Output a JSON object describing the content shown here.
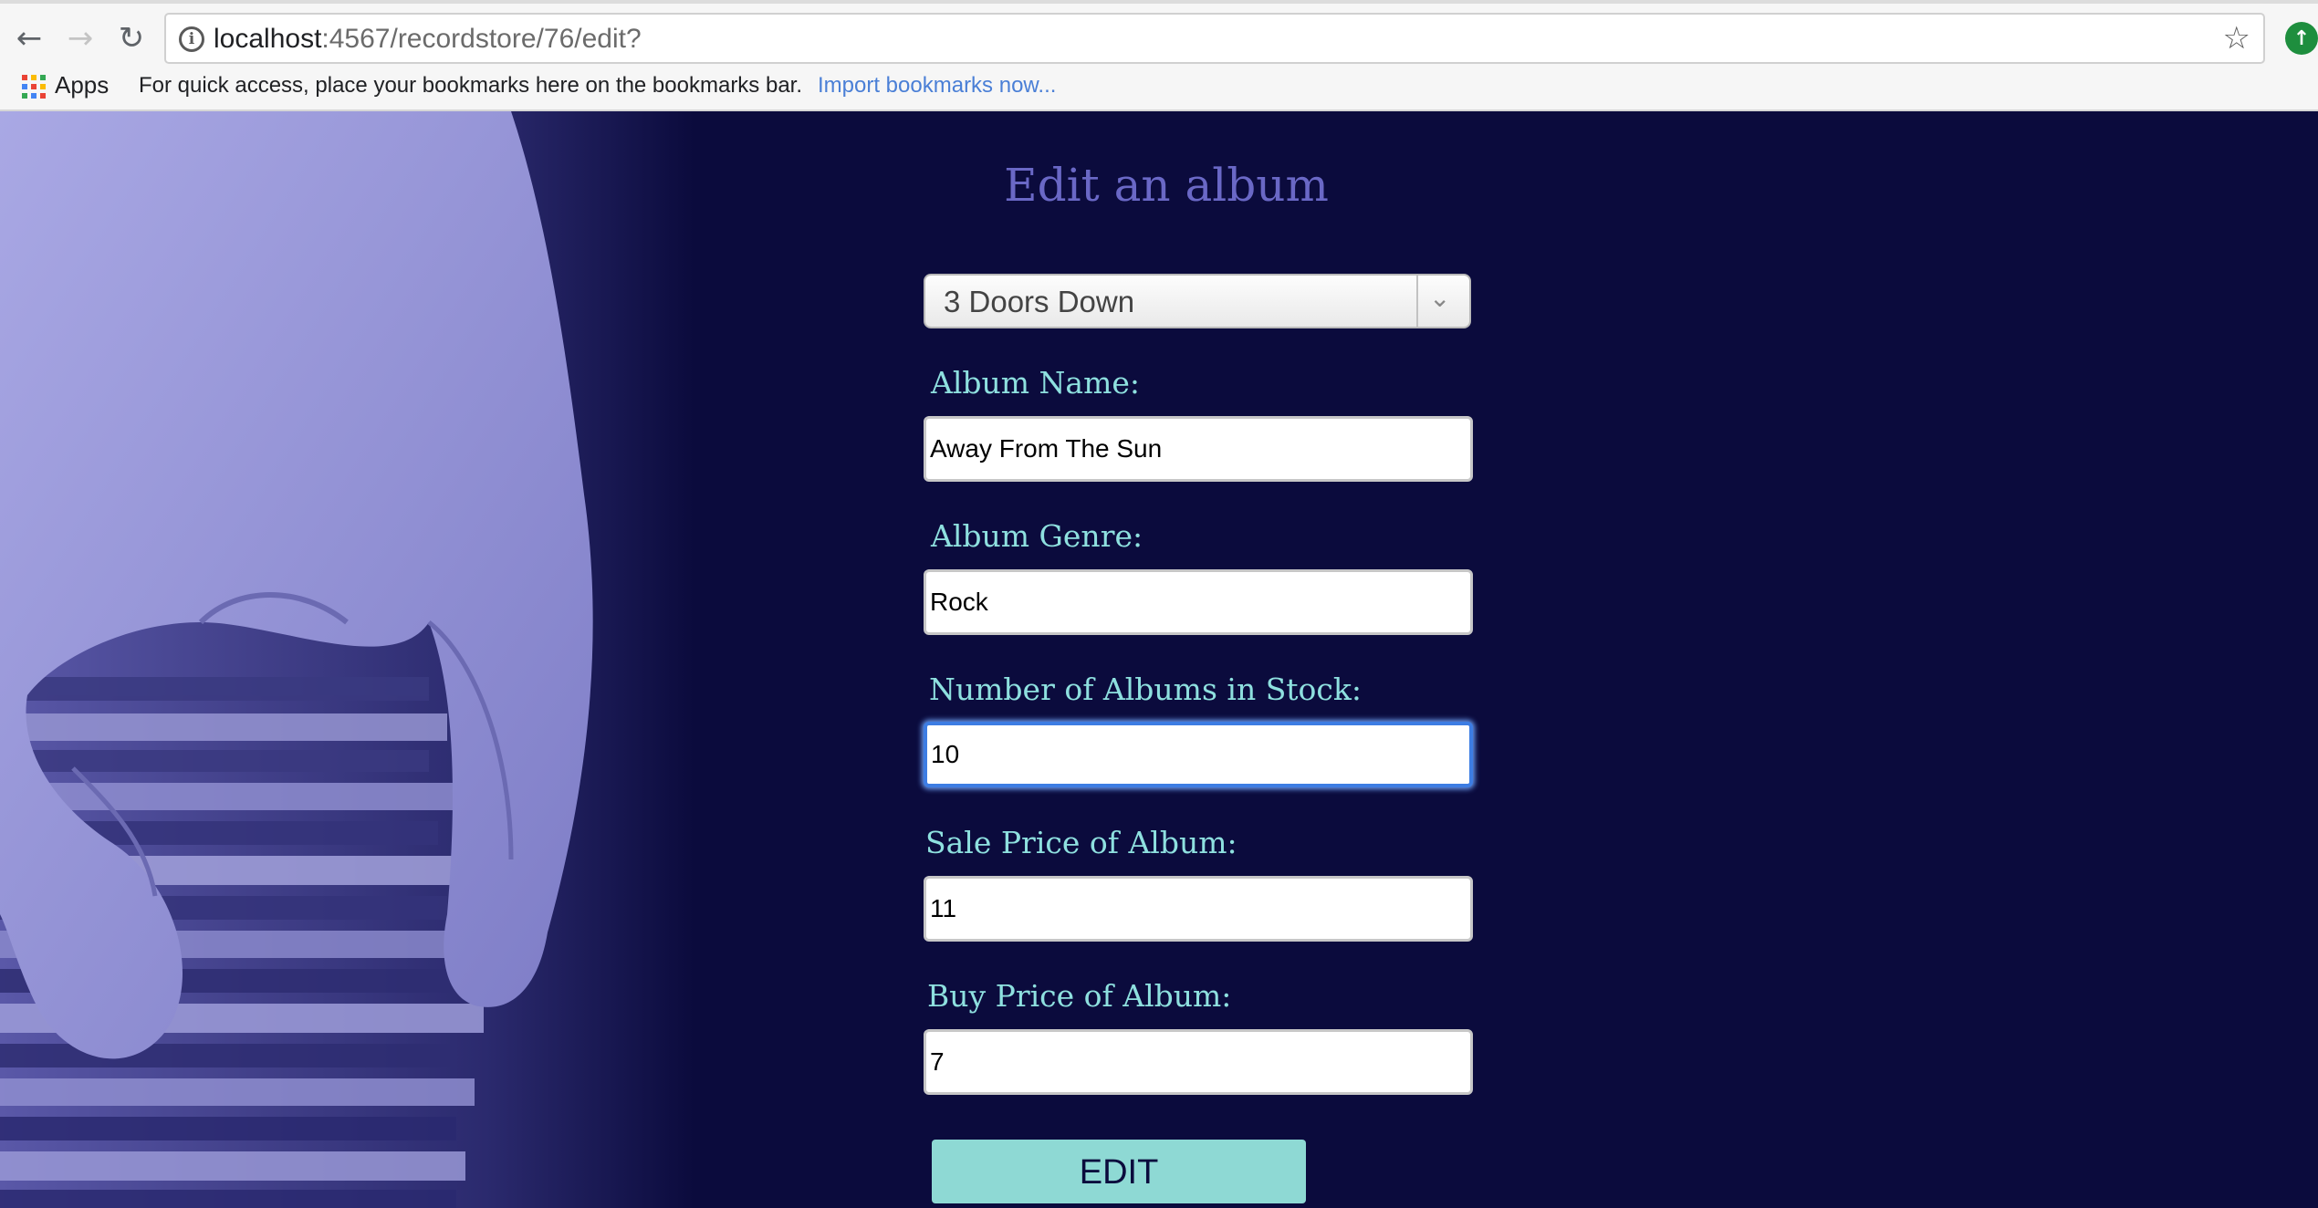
{
  "browser": {
    "url_host": "localhost",
    "url_path": ":4567/recordstore/76/edit?",
    "bookmarks": {
      "apps_label": "Apps",
      "hint": "For quick access, place your bookmarks here on the bookmarks bar.",
      "import_link": "Import bookmarks now..."
    }
  },
  "form": {
    "title": "Edit an album",
    "artist_select": {
      "value": "3 Doors Down"
    },
    "fields": {
      "album_name": {
        "label": "Album Name:",
        "value": "Away From The Sun"
      },
      "album_genre": {
        "label": "Album Genre:",
        "value": "Rock"
      },
      "stock": {
        "label": "Number of Albums in Stock:",
        "value": "10"
      },
      "sale_price": {
        "label": "Sale Price of Album:",
        "value": "11"
      },
      "buy_price": {
        "label": "Buy Price of Album:",
        "value": "7"
      }
    },
    "submit_label": "EDIT"
  },
  "colors": {
    "page_background": "#0b0b3d",
    "title": "#6a68c6",
    "label": "#8ee0df",
    "button": "#8ed9d4",
    "focus_ring": "#3d7de3"
  },
  "icons": [
    "back-icon",
    "forward-icon",
    "reload-icon",
    "info-icon",
    "star-icon",
    "update-icon",
    "apps-icon",
    "chevron-down-icon"
  ]
}
